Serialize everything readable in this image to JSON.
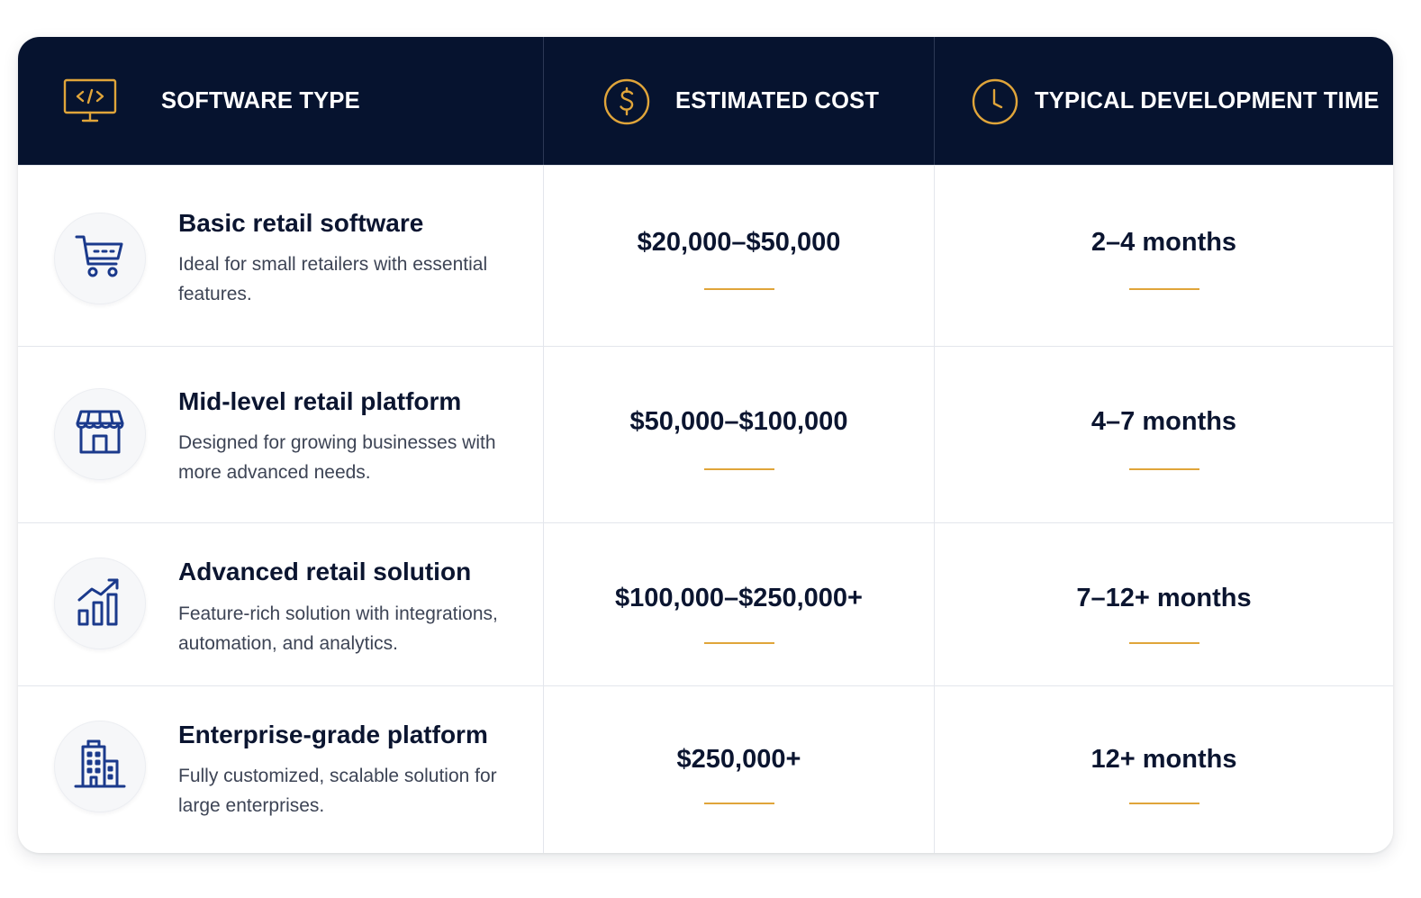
{
  "header": {
    "software_type": "SOFTWARE TYPE",
    "estimated_cost": "ESTIMATED COST",
    "development_time": "TYPICAL DEVELOPMENT TIME"
  },
  "icons": {
    "header_software": "code-monitor-icon",
    "header_cost": "dollar-coin-icon",
    "header_time": "clock-icon",
    "row_1": "shopping-cart-icon",
    "row_2": "storefront-icon",
    "row_3": "growth-chart-icon",
    "row_4": "office-building-icon"
  },
  "colors": {
    "header_bg": "#06132f",
    "accent": "#e0a53a",
    "icon_blue": "#1b3a8c",
    "text_dark": "#0b1530"
  },
  "rows": [
    {
      "title": "Basic retail software",
      "description": "Ideal for small retailers with essential features.",
      "cost": "$20,000–$50,000",
      "time": "2–4 months"
    },
    {
      "title": "Mid-level retail platform",
      "description": "Designed for growing businesses with more advanced needs.",
      "cost": "$50,000–$100,000",
      "time": "4–7 months"
    },
    {
      "title": "Advanced retail solution",
      "description": "Feature-rich solution with integrations, automation, and analytics.",
      "cost": "$100,000–$250,000+",
      "time": "7–12+ months"
    },
    {
      "title": "Enterprise-grade platform",
      "description": "Fully customized, scalable solution for large enterprises.",
      "cost": "$250,000+",
      "time": "12+ months"
    }
  ]
}
